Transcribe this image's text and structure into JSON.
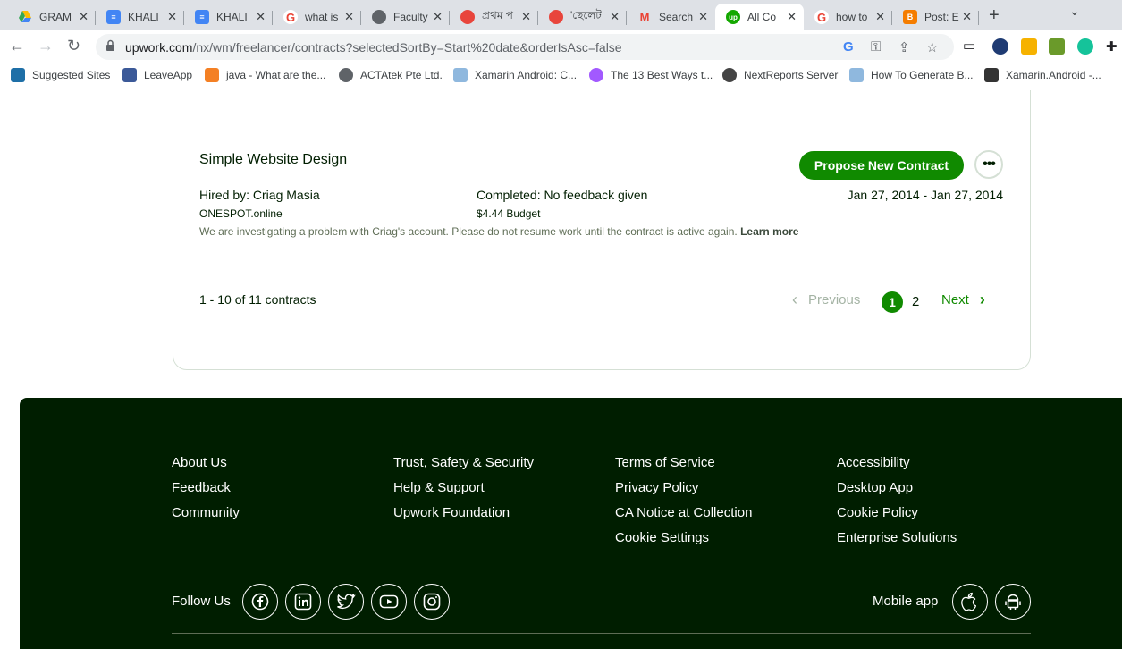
{
  "browser": {
    "tabs": [
      {
        "title": "GRAM",
        "icon": "google-drive-icon",
        "color": "#1a73e8"
      },
      {
        "title": "KHALI",
        "icon": "google-docs-icon",
        "color": "#4285f4"
      },
      {
        "title": "KHALI",
        "icon": "google-docs-icon",
        "color": "#4285f4"
      },
      {
        "title": "what is",
        "icon": "google-icon",
        "color": "#ea4335"
      },
      {
        "title": "Faculty",
        "icon": "globe-icon",
        "color": "#5f6368"
      },
      {
        "title": "প্রথম প",
        "icon": "flower-icon",
        "color": "#e8453c"
      },
      {
        "title": "'ছেলেট",
        "icon": "flower-icon",
        "color": "#e8453c"
      },
      {
        "title": "Search",
        "icon": "gmail-icon",
        "color": "#ea4335"
      },
      {
        "title": "All Co",
        "icon": "upwork-icon",
        "color": "#14a800"
      },
      {
        "title": "how to",
        "icon": "google-icon",
        "color": "#ea4335"
      },
      {
        "title": "Post: E",
        "icon": "blogger-icon",
        "color": "#f57d00"
      }
    ],
    "url_host": "upwork.com",
    "url_path": "/nx/wm/freelancer/contracts?selectedSortBy=Start%20date&orderIsAsc=false",
    "bookmarks": [
      {
        "label": "Suggested Sites",
        "color": "#1e6fa7"
      },
      {
        "label": "LeaveApp",
        "color": "#3b5998"
      },
      {
        "label": "java - What are the...",
        "color": "#f48024"
      },
      {
        "label": "ACTAtek Pte Ltd.",
        "color": "#5f6368"
      },
      {
        "label": "Xamarin Android: C...",
        "color": "#8fb8de"
      },
      {
        "label": "The 13 Best Ways t...",
        "color": "#a259ff"
      },
      {
        "label": "NextReports Server",
        "color": "#444444"
      },
      {
        "label": "How To Generate B...",
        "color": "#8fb8de"
      },
      {
        "label": "Xamarin.Android -...",
        "color": "#333333"
      }
    ]
  },
  "contract": {
    "title": "Simple Website Design",
    "propose_label": "Propose New Contract",
    "more_label": "•••",
    "hired_by": "Hired by: Criag Masia",
    "company": "ONESPOT.online",
    "status": "Completed: No feedback given",
    "budget": "$4.44 Budget",
    "dates": "Jan 27, 2014 - Jan 27, 2014",
    "notice": "We are investigating a problem with Criag's account. Please do not resume work until the contract is active again.",
    "learn_more": "Learn more"
  },
  "pagination": {
    "summary": "1 - 10 of 11 contracts",
    "previous": "Previous",
    "page1": "1",
    "page2": "2",
    "next": "Next"
  },
  "footer": {
    "col1": [
      "About Us",
      "Feedback",
      "Community"
    ],
    "col2": [
      "Trust, Safety & Security",
      "Help & Support",
      "Upwork Foundation"
    ],
    "col3": [
      "Terms of Service",
      "Privacy Policy",
      "CA Notice at Collection",
      "Cookie Settings"
    ],
    "col4": [
      "Accessibility",
      "Desktop App",
      "Cookie Policy",
      "Enterprise Solutions"
    ],
    "follow_label": "Follow Us",
    "social": [
      "facebook-icon",
      "linkedin-icon",
      "twitter-icon",
      "youtube-icon",
      "instagram-icon"
    ],
    "mobile_label": "Mobile app",
    "apps": [
      "apple-icon",
      "android-icon"
    ]
  },
  "colors": {
    "brand_green": "#108a00",
    "footer_bg": "#001e00"
  }
}
